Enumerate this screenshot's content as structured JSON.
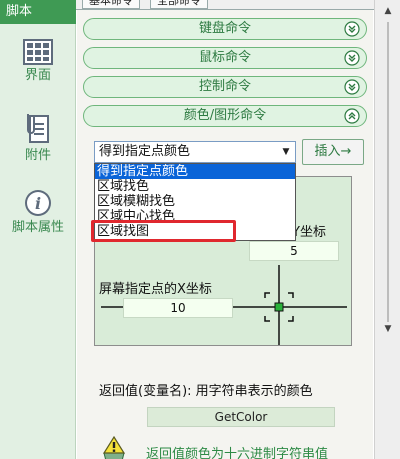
{
  "sidebar": {
    "header": "脚本",
    "items": [
      {
        "label": "界面",
        "icon": "grid-icon"
      },
      {
        "label": "附件",
        "icon": "paperclip-icon"
      },
      {
        "label": "脚本属性",
        "icon": "info-icon"
      }
    ]
  },
  "tabs": [
    {
      "label": "基本命令"
    },
    {
      "label": "全部命令"
    }
  ],
  "commands": [
    {
      "label": "键盘命令",
      "state": "collapsed"
    },
    {
      "label": "鼠标命令",
      "state": "collapsed"
    },
    {
      "label": "控制命令",
      "state": "collapsed"
    },
    {
      "label": "颜色/图形命令",
      "state": "expanded"
    }
  ],
  "dropdown": {
    "selected": "得到指定点颜色",
    "options": [
      {
        "label": "得到指定点颜色",
        "selected": true
      },
      {
        "label": "区域找色",
        "selected": false
      },
      {
        "label": "区域模糊找色",
        "selected": false
      },
      {
        "label": "区域中心找色",
        "selected": false
      },
      {
        "label": "区域找图",
        "selected": false
      }
    ]
  },
  "insert_button": {
    "label": "插入→"
  },
  "coord_panel": {
    "y_label": "的Y坐标",
    "y_value": "5",
    "x_label": "屏幕指定点的X坐标",
    "x_value": "10"
  },
  "return_section": {
    "label": "返回值(变量名): 用字符串表示的颜色",
    "value": "GetColor",
    "hint": "返回值颜色为十六进制字符串值"
  },
  "colors": {
    "brand_green": "#3f9a54",
    "highlight_red": "#e0282e",
    "selection_blue": "#0a64d8"
  }
}
